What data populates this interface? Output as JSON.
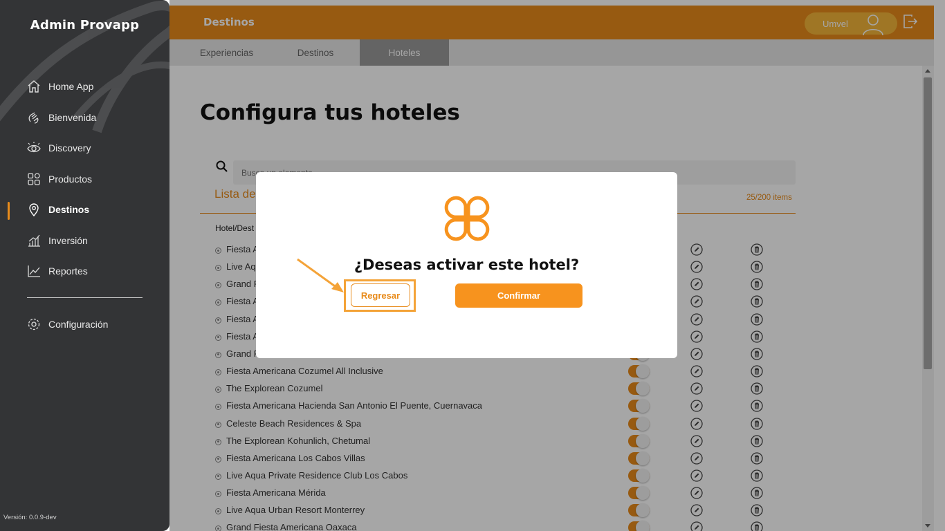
{
  "sidebar": {
    "brand": "Admin Provapp",
    "items": [
      {
        "label": "Home App",
        "icon": "home-icon"
      },
      {
        "label": "Bienvenida",
        "icon": "wave-hand-icon"
      },
      {
        "label": "Discovery",
        "icon": "eye-icon"
      },
      {
        "label": "Productos",
        "icon": "grid-icon"
      },
      {
        "label": "Destinos",
        "icon": "location-pin-icon"
      },
      {
        "label": "Inversión",
        "icon": "bar-chart-icon"
      },
      {
        "label": "Reportes",
        "icon": "line-chart-icon"
      },
      {
        "label": "Configuración",
        "icon": "gear-icon"
      }
    ],
    "version": "Versión: 0.0.9-dev"
  },
  "header": {
    "section_title": "Destinos",
    "user_name": "Umvel"
  },
  "tabs": [
    {
      "label": "Experiencias"
    },
    {
      "label": "Destinos"
    },
    {
      "label": "Hoteles"
    }
  ],
  "main": {
    "title": "Configura tus hoteles",
    "search_placeholder": "Busca un elemento",
    "list_title": "Lista de",
    "items_count": "25/200 items",
    "column_header": "Hotel/Dest",
    "rows": [
      "Fiesta A",
      "Live Aq",
      "Grand F",
      "Fiesta A",
      "Fiesta A",
      "Fiesta A",
      "Grand F",
      "Fiesta Americana Cozumel All Inclusive",
      "The Explorean Cozumel",
      "Fiesta Americana Hacienda San Antonio El Puente, Cuernavaca",
      "Celeste Beach Residences & Spa",
      "The Explorean Kohunlich, Chetumal",
      "Fiesta Americana Los Cabos Villas",
      "Live Aqua Private Residence Club Los Cabos",
      "Fiesta Americana Mérida",
      "Live Aqua Urban Resort Monterrey",
      "Grand Fiesta Americana Oaxaca"
    ]
  },
  "modal": {
    "question": "¿Deseas activar este hotel?",
    "back_label": "Regresar",
    "confirm_label": "Confirmar"
  },
  "colors": {
    "accent": "#e88b1b",
    "sidebar_bg": "#333436",
    "confirm_bg": "#f7931e"
  }
}
